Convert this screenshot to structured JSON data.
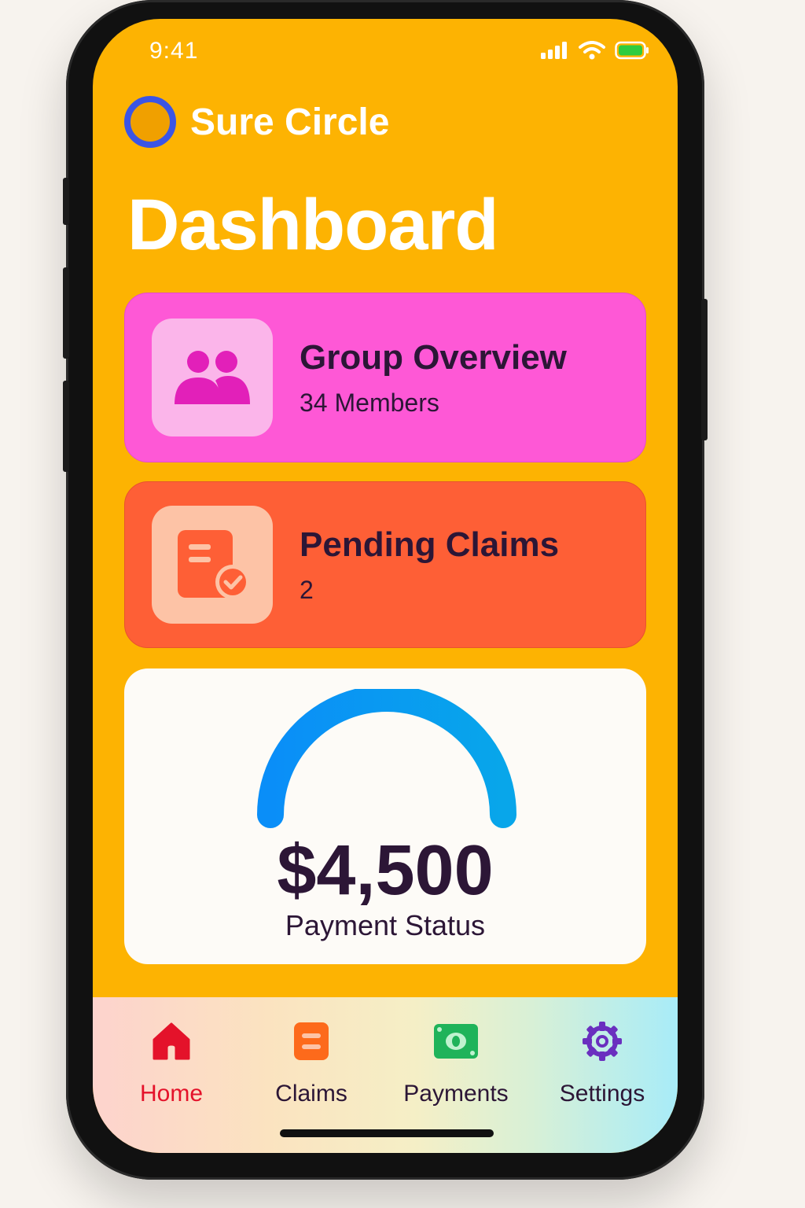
{
  "status_bar": {
    "time": "9:41"
  },
  "brand": {
    "name": "Sure Circle"
  },
  "page": {
    "title": "Dashboard"
  },
  "cards": {
    "group": {
      "title": "Group Overview",
      "subtitle": "34 Members",
      "color": "#fe58d6"
    },
    "claims": {
      "title": "Pending Claims",
      "subtitle": "2",
      "color": "#fe5f36"
    }
  },
  "payment": {
    "amount": "$4,500",
    "label": "Payment Status",
    "gauge_color": "#0a8ef8"
  },
  "tabs": [
    {
      "label": "Home",
      "icon": "home-icon",
      "active": true
    },
    {
      "label": "Claims",
      "icon": "claims-icon",
      "active": false
    },
    {
      "label": "Payments",
      "icon": "payments-icon",
      "active": false
    },
    {
      "label": "Settings",
      "icon": "gear-icon",
      "active": false
    }
  ],
  "colors": {
    "background": "#fdb302",
    "accent_active": "#e4122a",
    "text_dark": "#2c1636"
  }
}
